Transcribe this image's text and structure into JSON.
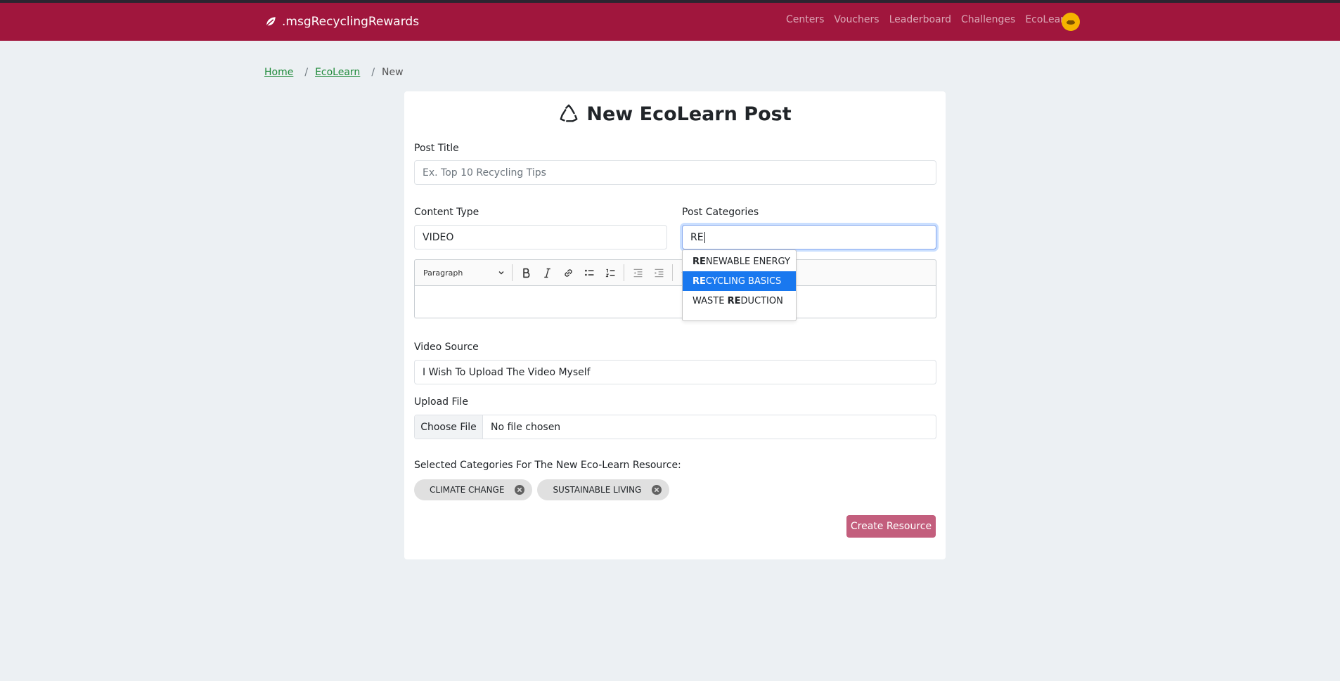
{
  "nav": {
    "brand": ".msgRecyclingRewards",
    "links": [
      "Centers",
      "Vouchers",
      "Leaderboard",
      "Challenges",
      "EcoLearn"
    ]
  },
  "breadcrumb": {
    "home": "Home",
    "section": "EcoLearn",
    "current": "New"
  },
  "form": {
    "title": "New EcoLearn Post",
    "post_title_label": "Post Title",
    "post_title_placeholder": "Ex. Top 10 Recycling Tips",
    "content_type_label": "Content Type",
    "content_type_value": "VIDEO",
    "categories_label": "Post Categories",
    "categories_query": "RE",
    "editor_paragraph": "Paragraph",
    "video_source_label": "Video Source",
    "video_source_value": "I Wish To Upload The Video Myself",
    "upload_label": "Upload File",
    "choose_file": "Choose File",
    "no_file": "No file chosen",
    "selected_label": "Selected Categories For The New Eco-Learn Resource:",
    "selected_categories": [
      "CLIMATE CHANGE",
      "SUSTAINABLE LIVING"
    ],
    "submit_label": "Create Resource"
  },
  "autocomplete": {
    "highlighted_index": 1,
    "options": [
      {
        "before": "",
        "match": "RE",
        "after": "NEWABLE ENERGY"
      },
      {
        "before": "",
        "match": "RE",
        "after": "CYCLING BASICS"
      },
      {
        "before": "WASTE ",
        "match": "RE",
        "after": "DUCTION"
      }
    ]
  },
  "colors": {
    "navbar": "#a0163d",
    "accent_link": "#1f8a3a",
    "submit": "#c35e7d",
    "highlight": "#1978ef"
  }
}
